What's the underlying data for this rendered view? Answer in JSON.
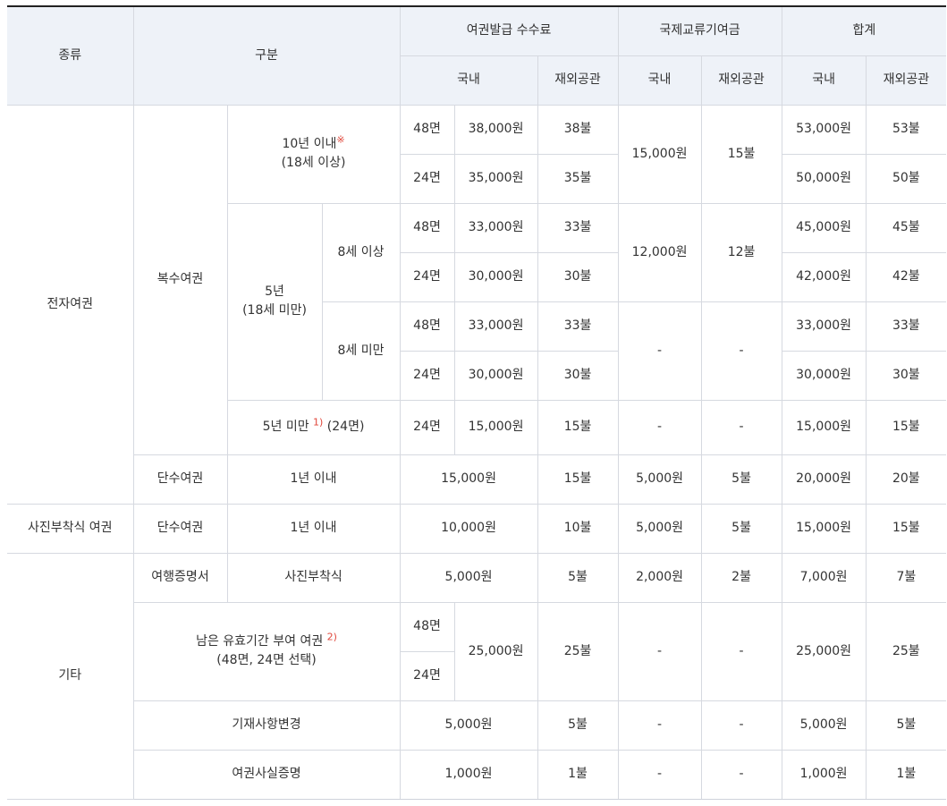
{
  "header": {
    "type": "종류",
    "category": "구분",
    "issue_fee": "여권발급 수수료",
    "exchange_fund": "국제교류기여금",
    "total": "합계",
    "domestic": "국내",
    "overseas": "재외공관"
  },
  "labels": {
    "epassport": "전자여권",
    "multiple": "복수여권",
    "single": "단수여권",
    "photo_passport": "사진부착식 여권",
    "other": "기타",
    "ten_years": "10년 이내",
    "ten_years_mark": "※",
    "age_18_over": "(18세 이상)",
    "five_years": "5년",
    "age_18_under": "(18세 미만)",
    "age_8_over": "8세 이상",
    "age_8_under": "8세 미만",
    "under_five_years": "5년 미만",
    "under_five_years_mark": "1)",
    "under_five_years_pages": " (24면)",
    "within_one_year": "1년 이내",
    "travel_certificate": "여행증명서",
    "photo_attached": "사진부착식",
    "remaining_validity": "남은 유효기간 부여 여권",
    "remaining_validity_mark": "2)",
    "remaining_validity_choice": "(48면, 24면 선택)",
    "amendment": "기재사항변경",
    "fact_certificate": "여권사실증명",
    "pages48": "48면",
    "pages24": "24면",
    "dash": "-"
  },
  "fees": {
    "ten48": {
      "dom": "38,000원",
      "ovs": "38불",
      "tdom": "53,000원",
      "tovs": "53불"
    },
    "ten24": {
      "dom": "35,000원",
      "ovs": "35불",
      "tdom": "50,000원",
      "tovs": "50불"
    },
    "ten_fund": {
      "dom": "15,000원",
      "ovs": "15불"
    },
    "five_over48": {
      "dom": "33,000원",
      "ovs": "33불",
      "tdom": "45,000원",
      "tovs": "45불"
    },
    "five_over24": {
      "dom": "30,000원",
      "ovs": "30불",
      "tdom": "42,000원",
      "tovs": "42불"
    },
    "five_fund": {
      "dom": "12,000원",
      "ovs": "12불"
    },
    "five_under48": {
      "dom": "33,000원",
      "ovs": "33불",
      "tdom": "33,000원",
      "tovs": "33불"
    },
    "five_under24": {
      "dom": "30,000원",
      "ovs": "30불",
      "tdom": "30,000원",
      "tovs": "30불"
    },
    "lt_five": {
      "dom": "15,000원",
      "ovs": "15불",
      "tdom": "15,000원",
      "tovs": "15불"
    },
    "single_e": {
      "dom": "15,000원",
      "ovs": "15불",
      "fdom": "5,000원",
      "fovs": "5불",
      "tdom": "20,000원",
      "tovs": "20불"
    },
    "single_photo": {
      "dom": "10,000원",
      "ovs": "10불",
      "fdom": "5,000원",
      "fovs": "5불",
      "tdom": "15,000원",
      "tovs": "15불"
    },
    "travel_cert": {
      "dom": "5,000원",
      "ovs": "5불",
      "fdom": "2,000원",
      "fovs": "2불",
      "tdom": "7,000원",
      "tovs": "7불"
    },
    "remaining": {
      "dom": "25,000원",
      "ovs": "25불",
      "tdom": "25,000원",
      "tovs": "25불"
    },
    "amendment": {
      "dom": "5,000원",
      "ovs": "5불",
      "tdom": "5,000원",
      "tovs": "5불"
    },
    "fact_cert": {
      "dom": "1,000원",
      "ovs": "1불",
      "tdom": "1,000원",
      "tovs": "1불"
    }
  }
}
